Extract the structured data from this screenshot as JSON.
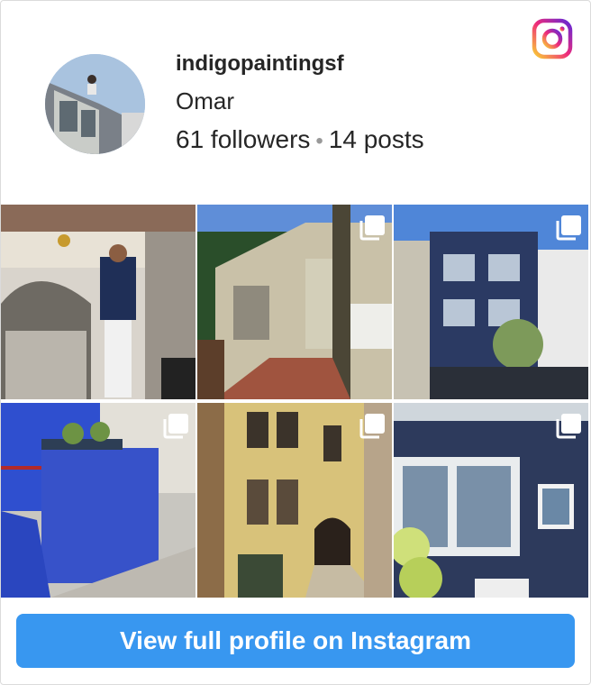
{
  "profile": {
    "username": "indigopaintingsf",
    "name": "Omar",
    "followers": "61 followers",
    "separator": "•",
    "posts": "14 posts"
  },
  "brand": {
    "logo_icon": "instagram-icon",
    "gradient": [
      "#f9ce34",
      "#ee2a7b",
      "#6228d7"
    ]
  },
  "grid": {
    "tiles": [
      {
        "name": "post-painter-ornate-entry",
        "multi": false
      },
      {
        "name": "post-porch-steps",
        "multi": true
      },
      {
        "name": "post-navy-bay-windows",
        "multi": true
      },
      {
        "name": "post-blue-stairs-cabinet",
        "multi": true
      },
      {
        "name": "post-yellow-house",
        "multi": true
      },
      {
        "name": "post-navy-facade",
        "multi": true
      }
    ],
    "multi_icon": "carousel-icon"
  },
  "footer": {
    "cta_label": "View full profile on Instagram",
    "accent": "#3897f0"
  }
}
